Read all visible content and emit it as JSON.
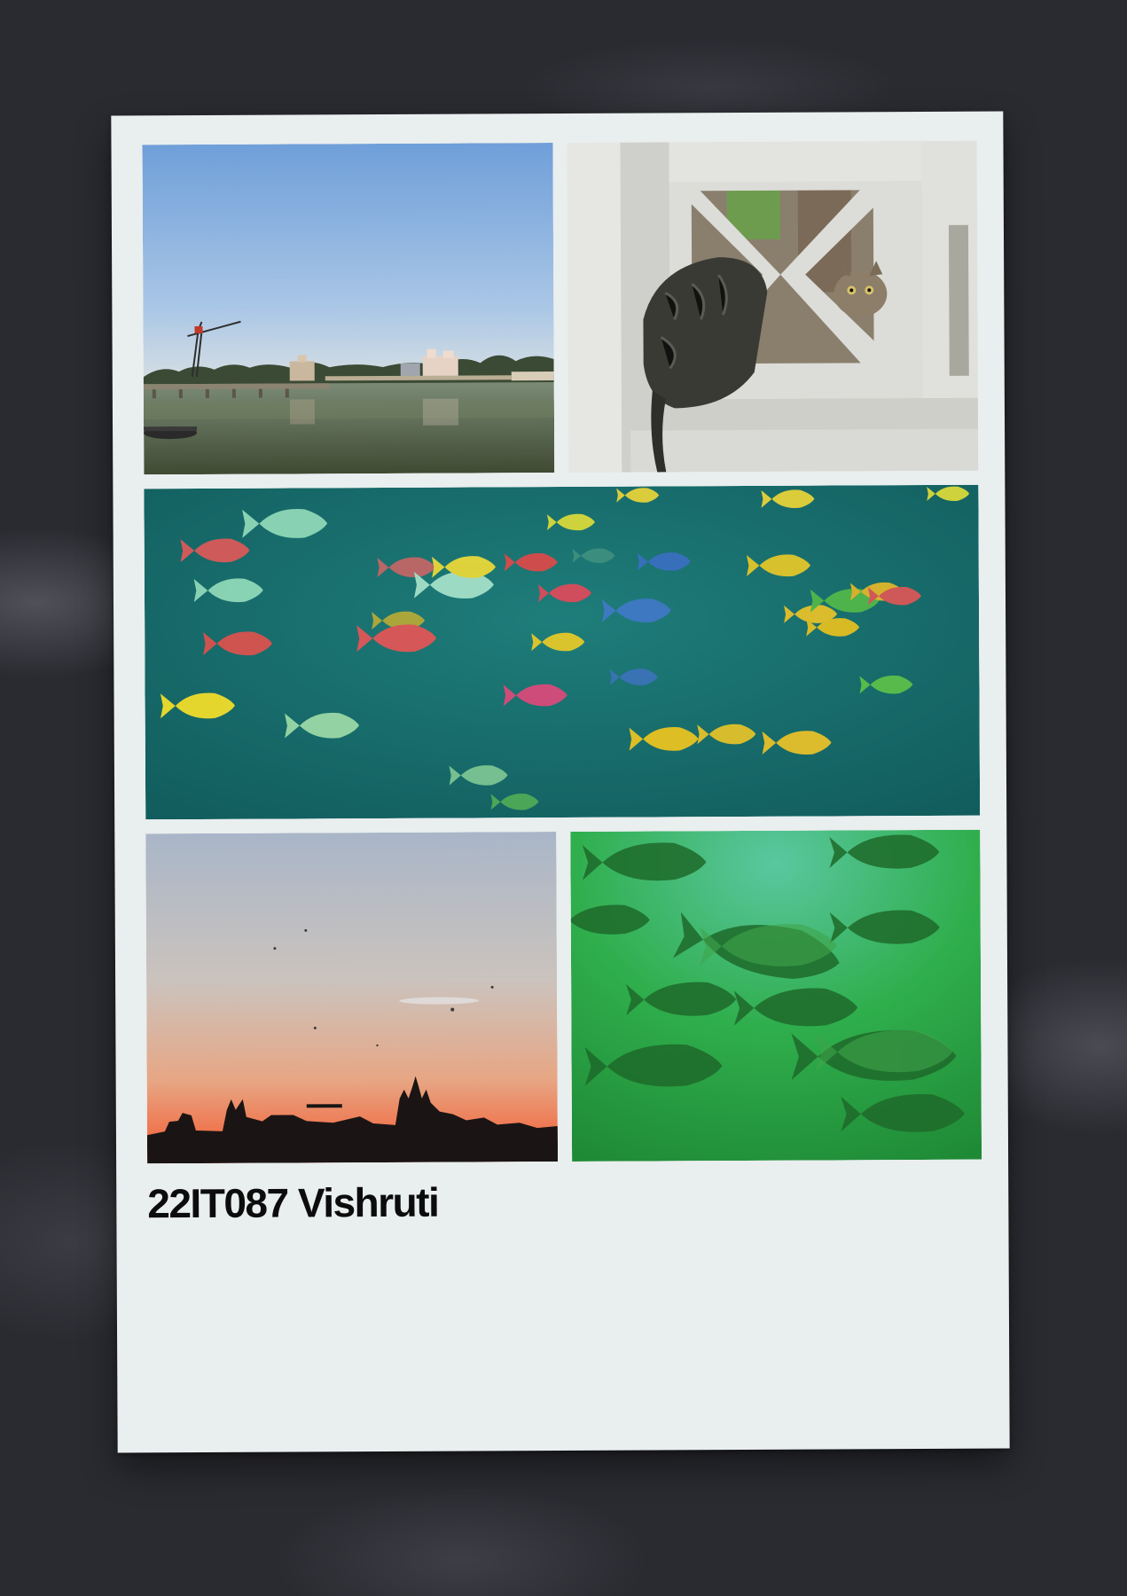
{
  "poster": {
    "caption": "22IT087 Vishruti",
    "background_color": "#2a2b31",
    "card_color": "#e9eeee"
  },
  "photos": [
    {
      "subject": "lake-with-crane-and-bridge"
    },
    {
      "subject": "cat-behind-cross-lattice-wall"
    },
    {
      "subject": "colorful-aquarium-fish"
    },
    {
      "subject": "sunset-skyline"
    },
    {
      "subject": "green-aquarium-tilapia"
    }
  ]
}
